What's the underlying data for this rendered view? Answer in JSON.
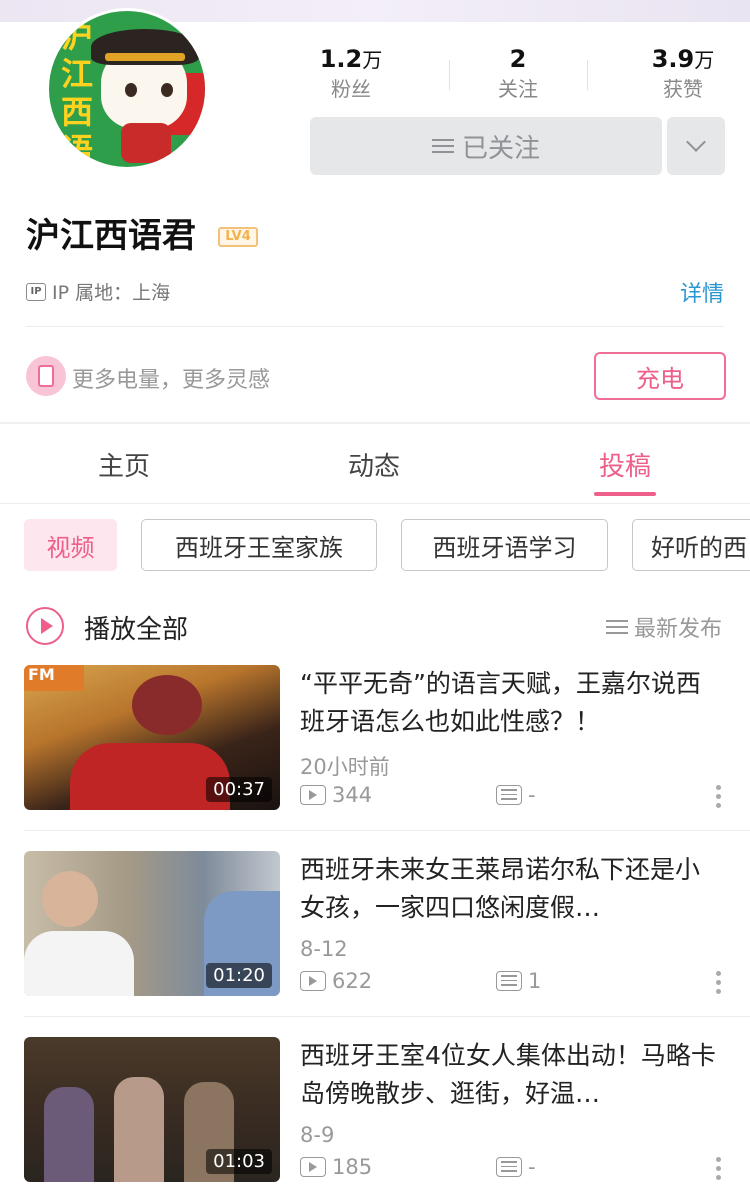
{
  "profile": {
    "name": "沪江西语君",
    "level": "LV4",
    "avatar_text": "沪江西语",
    "ip_label": "IP 属地：上海",
    "detail_link": "详情"
  },
  "stats": [
    {
      "num": "1.2",
      "unit": "万",
      "label": "粉丝"
    },
    {
      "num": "2",
      "unit": "",
      "label": "关注"
    },
    {
      "num": "3.9",
      "unit": "万",
      "label": "获赞"
    }
  ],
  "follow_button": "已关注",
  "charge": {
    "text": "更多电量，更多灵感",
    "button": "充电"
  },
  "tabs": [
    {
      "label": "主页",
      "active": false
    },
    {
      "label": "动态",
      "active": false
    },
    {
      "label": "投稿",
      "active": true
    }
  ],
  "chips": [
    {
      "label": "视频",
      "active": true
    },
    {
      "label": "西班牙王室家族",
      "active": false
    },
    {
      "label": "西班牙语学习",
      "active": false
    },
    {
      "label": "好听的西",
      "active": false
    }
  ],
  "play_all": "播放全部",
  "sort": "最新发布",
  "videos": [
    {
      "title": "“平平无奇”的语言天赋，王嘉尔说西班牙语怎么也如此性感？！",
      "time": "20小时前",
      "plays": "344",
      "danmaku": "-",
      "duration": "00:37"
    },
    {
      "title": "西班牙未来女王莱昂诺尔私下还是小女孩，一家四口悠闲度假…",
      "time": "8-12",
      "plays": "622",
      "danmaku": "1",
      "duration": "01:20"
    },
    {
      "title": "西班牙王室4位女人集体出动！马略卡岛傍晚散步、逛街，好温…",
      "time": "8-9",
      "plays": "185",
      "danmaku": "-",
      "duration": "01:03"
    }
  ],
  "colors": {
    "accent": "#ee5f8a",
    "link": "#2a97d2",
    "avatar_bg": "#2f9e4b"
  }
}
